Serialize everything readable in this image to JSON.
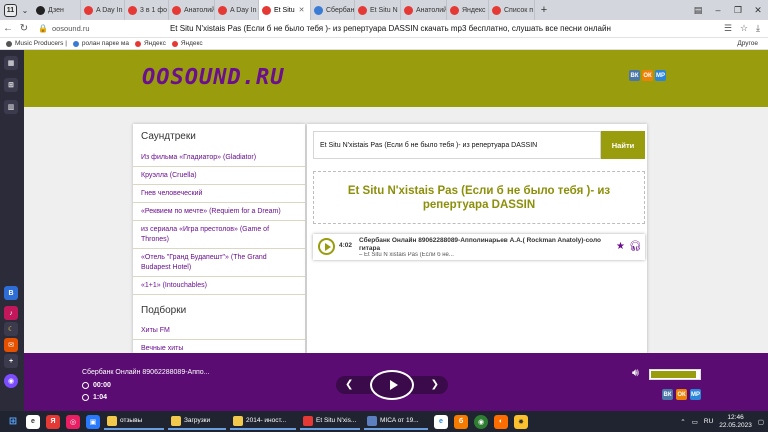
{
  "browser": {
    "tab_count": "11",
    "tabs": [
      {
        "label": "Дзен",
        "color": "#222222"
      },
      {
        "label": "A Day In",
        "color": "#e53935"
      },
      {
        "label": "3 в 1 фо",
        "color": "#e53935"
      },
      {
        "label": "Анатолий",
        "color": "#e53935"
      },
      {
        "label": "A Day In",
        "color": "#e53935"
      },
      {
        "label": "Et Situ",
        "color": "#e53935",
        "active": true
      },
      {
        "label": "Сбербан",
        "color": "#3a7bd5"
      },
      {
        "label": "Et Situ N",
        "color": "#e53935"
      },
      {
        "label": "Анатолий",
        "color": "#e53935"
      },
      {
        "label": "Яндекс",
        "color": "#e53935"
      },
      {
        "label": "Список п",
        "color": "#e53935"
      }
    ],
    "url": "oosound.ru",
    "page_title": "Et Situ N'xistais Pas (Если б не было тебя )- из репертуара DASSIN скачать mp3 бесплатно, слушать все песни онлайн",
    "bookmarks": [
      {
        "label": "Music Producers |",
        "color": "#555555"
      },
      {
        "label": "ролан парке ма",
        "color": "#3a7bd5"
      },
      {
        "label": "Яндекс",
        "color": "#e53935"
      },
      {
        "label": "Яндекс",
        "color": "#e53935"
      }
    ],
    "other_bookmarks": "Другое"
  },
  "site": {
    "logo": "OOSOUND.RU",
    "social": [
      "ВК",
      "ОК",
      "МР"
    ]
  },
  "sidebar": {
    "section1_title": "Саундтреки",
    "section1_items": [
      "Из фильма «Гладиатор» (Gladiator)",
      "Круэлла (Cruella)",
      "Гнев человеческий",
      "«Реквием по мечте» (Requiem for a Dream)",
      "из сериала «Игра престолов» (Game of Thrones)",
      "«Отель \"Гранд Будапешт\"» (The Grand Budapest Hotel)",
      "«1+1» (Intouchables)"
    ],
    "section2_title": "Подборки",
    "section2_items": [
      "Хиты FM",
      "Вечные хиты"
    ]
  },
  "main": {
    "search_value": "Et  Situ  N'xistais  Pas (Если б не было тебя )- из репертуара DASSIN",
    "search_button": "Найти",
    "heading": "Et Situ N'xistais Pas (Если б не было тебя )- из репертуара DASSIN",
    "track": {
      "duration": "4:02",
      "artist": "Сбербанк Онлайн 89062288089-Апполинарьев А.А.( Rockman Anatoly)-соло гитара",
      "title": "– Et Situ N xistais Pas (Если б не..."
    }
  },
  "player": {
    "now_playing": "Сбербанк Онлайн 89062288089-Аппо...",
    "time_current": "00:00",
    "time_total": "1:04",
    "volume": 0.9
  },
  "taskbar": {
    "apps": [
      {
        "label": "отзывы",
        "color": "#f2c94c"
      },
      {
        "label": "Загрузки",
        "color": "#f2c94c"
      },
      {
        "label": "2014- иност...",
        "color": "#f2c94c"
      },
      {
        "label": "Et Situ N'xis...",
        "color": "#e53935"
      },
      {
        "label": "MICA от 19...",
        "color": "#5b7fbf"
      }
    ],
    "lang": "RU",
    "time": "12:46",
    "date": "22.05.2023"
  }
}
